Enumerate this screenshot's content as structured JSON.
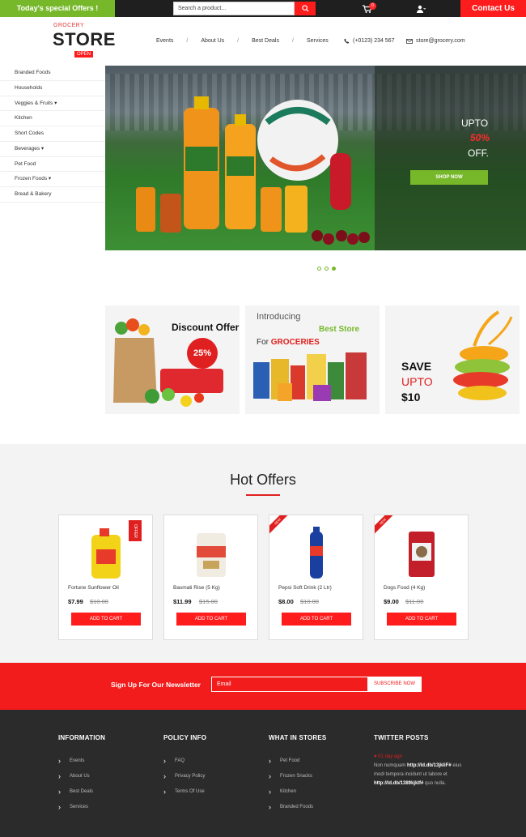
{
  "topbar": {
    "special_offers": "Today's special Offers !",
    "search_placeholder": "Search a product...",
    "cart_count": "0",
    "contact": "Contact Us"
  },
  "header": {
    "logo_small": "GROCERY",
    "logo_big": "STORE",
    "logo_badge": "OPEN",
    "nav": [
      "Events",
      "About Us",
      "Best Deals",
      "Services"
    ],
    "phone": "(+0123) 234 567",
    "email": "store@grocery.com"
  },
  "sidebar": {
    "categories": [
      "Branded Foods",
      "Households",
      "Veggies & Fruits ▾",
      "Kitchen",
      "Short Codes",
      "Beverages ▾",
      "Pet Food",
      "Frozen Foods ▾",
      "Bread & Bakery"
    ]
  },
  "hero": {
    "upto": "UPTO",
    "percent": "50%",
    "off": "OFF.",
    "shop_now": "SHOP NOW",
    "slide_count": 3,
    "active_slide": 3
  },
  "promos": {
    "discount_title": "Discount Offer",
    "discount_badge": "25%",
    "introducing": "Introducing",
    "best_store": "Best Store",
    "for_text": "For",
    "groceries": "GROCERIES",
    "save": "SAVE",
    "upto": "UPTO",
    "amount": "$10"
  },
  "hot_offers": {
    "title": "Hot Offers",
    "add_to_cart": "ADD TO CART",
    "products": [
      {
        "name": "Fortune Sunflower Oil",
        "price": "$7.99",
        "old_price": "$10.00",
        "badge": "OFFER"
      },
      {
        "name": "Basmati Rise (5 Kg)",
        "price": "$11.99",
        "old_price": "$15.00",
        "badge": ""
      },
      {
        "name": "Pepsi Soft Drink (2 Ltr)",
        "price": "$8.00",
        "old_price": "$10.00",
        "badge": "NEW"
      },
      {
        "name": "Dogs Food (4 Kg)",
        "price": "$9.00",
        "old_price": "$11.00",
        "badge": "NEW"
      }
    ]
  },
  "newsletter": {
    "label": "Sign Up For Our Newsletter",
    "placeholder": "Email",
    "button": "SUBSCRIBE NOW"
  },
  "footer": {
    "information": {
      "title": "INFORMATION",
      "links": [
        "Events",
        "About Us",
        "Best Deals",
        "Services"
      ]
    },
    "policy": {
      "title": "POLICY INFO",
      "links": [
        "FAQ",
        "Privacy Policy",
        "Terms Of Use"
      ]
    },
    "stores": {
      "title": "WHAT IN STORES",
      "links": [
        "Pet Food",
        "Frozen Snacks",
        "Kitchen",
        "Branded Foods"
      ]
    },
    "twitter": {
      "title": "TWITTER POSTS",
      "handle": "01 day ago",
      "line1": "Non numquam",
      "link1": "http://ld.db/13jkliF#",
      "line2": "eius modi tempora incidunt ut labore et",
      "link2": "http://ld.db/1389kjklf#",
      "line3": "quo nulla."
    }
  },
  "colors": {
    "accent_red": "#ff1c1c",
    "accent_green": "#76b82a",
    "dark": "#2b2b2b"
  }
}
